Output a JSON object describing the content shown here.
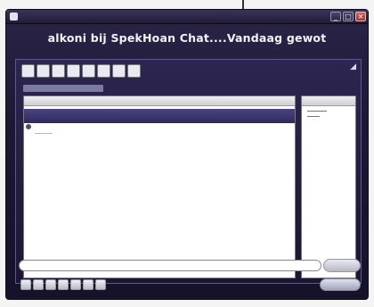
{
  "window": {
    "title": "",
    "channel_title": "alkoni bij SpekHoan Chat....Vandaag gewot"
  },
  "toolbar": {
    "buttons": [
      "",
      "",
      "",
      "",
      "",
      "",
      "",
      ""
    ]
  },
  "list": {
    "header": ""
  },
  "side": {
    "header": ""
  },
  "input": {
    "placeholder": "",
    "send_label": ""
  },
  "colors": {
    "window_bg": "#1d1833",
    "selection": "#4a4480",
    "panel_border": "#5f5890"
  }
}
